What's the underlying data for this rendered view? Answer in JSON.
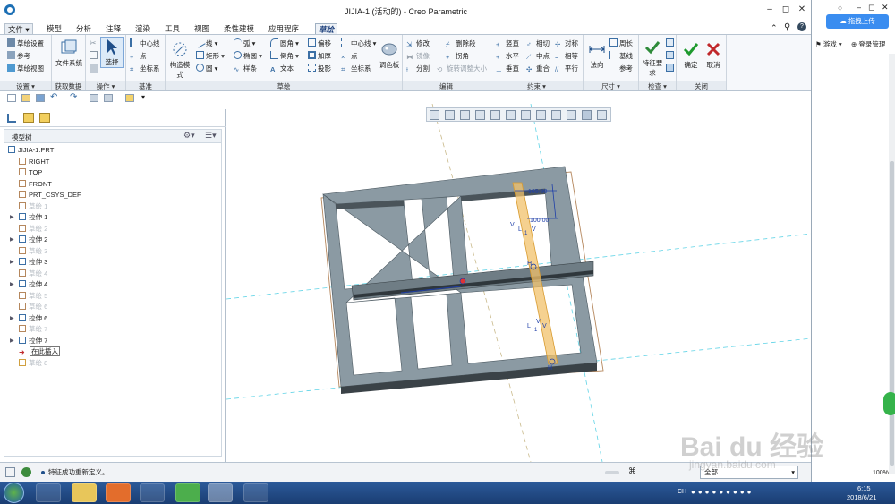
{
  "window": {
    "title": "JIJIA-1 (活动的) - Creo Parametric"
  },
  "menu": {
    "file": "文件",
    "tabs": [
      "模型",
      "分析",
      "注释",
      "渲染",
      "工具",
      "视图",
      "柔性建模",
      "应用程序"
    ],
    "active": "草绘"
  },
  "ribbon": {
    "setup": {
      "label": "设置",
      "items": [
        "草绘设置",
        "参考",
        "草绘视图"
      ]
    },
    "get_data": {
      "label": "获取数据",
      "file_system": "文件系统"
    },
    "operations": {
      "label": "操作",
      "select": "选择"
    },
    "datum": {
      "label": "基准",
      "items": [
        "中心线",
        "点",
        "坐标系"
      ]
    },
    "sketch": {
      "label": "草绘",
      "construct": "构造模式",
      "items": [
        "线",
        "弧",
        "圆角",
        "偏移",
        "中心线",
        "矩形",
        "椭圆",
        "倒角",
        "加厚",
        "点",
        "圆",
        "样条",
        "文本",
        "投影",
        "坐标系"
      ],
      "palette": "调色板"
    },
    "edit": {
      "label": "编辑",
      "items": [
        "修改",
        "删除段",
        "镜像",
        "拐角",
        "分割",
        "旋转调整大小"
      ]
    },
    "constrain": {
      "label": "约束",
      "items": [
        "竖直",
        "相切",
        "对称",
        "水平",
        "中点",
        "相等",
        "垂直",
        "重合",
        "平行"
      ]
    },
    "dimension": {
      "label": "尺寸",
      "normal": "法向",
      "items": [
        "周长",
        "基线",
        "参考"
      ]
    },
    "inspect": {
      "label": "检查",
      "feature_req": "特征要求"
    },
    "close": {
      "label": "关闭",
      "ok": "确定",
      "cancel": "取消"
    }
  },
  "model_tree": {
    "title": "模型树",
    "items": [
      {
        "label": "JIJIA-1.PRT",
        "kind": "part",
        "dim": false,
        "expand": false
      },
      {
        "label": "RIGHT",
        "kind": "plane",
        "dim": false,
        "expand": false
      },
      {
        "label": "TOP",
        "kind": "plane",
        "dim": false,
        "expand": false
      },
      {
        "label": "FRONT",
        "kind": "plane",
        "dim": false,
        "expand": false
      },
      {
        "label": "PRT_CSYS_DEF",
        "kind": "csys",
        "dim": false,
        "expand": false
      },
      {
        "label": "草绘 1",
        "kind": "sketch",
        "dim": true,
        "expand": false
      },
      {
        "label": "拉伸 1",
        "kind": "extrude",
        "dim": false,
        "expand": true
      },
      {
        "label": "草绘 2",
        "kind": "sketch",
        "dim": true,
        "expand": false
      },
      {
        "label": "拉伸 2",
        "kind": "extrude",
        "dim": false,
        "expand": true
      },
      {
        "label": "草绘 3",
        "kind": "sketch",
        "dim": true,
        "expand": false
      },
      {
        "label": "拉伸 3",
        "kind": "extrude",
        "dim": false,
        "expand": true
      },
      {
        "label": "草绘 4",
        "kind": "sketch",
        "dim": true,
        "expand": false
      },
      {
        "label": "拉伸 4",
        "kind": "extrude",
        "dim": false,
        "expand": true
      },
      {
        "label": "草绘 5",
        "kind": "sketch",
        "dim": true,
        "expand": false
      },
      {
        "label": "草绘 6",
        "kind": "sketch",
        "dim": true,
        "expand": false
      },
      {
        "label": "拉伸 6",
        "kind": "extrude",
        "dim": false,
        "expand": true
      },
      {
        "label": "草绘 7",
        "kind": "sketch",
        "dim": true,
        "expand": false
      },
      {
        "label": "拉伸 7",
        "kind": "extrude",
        "dim": false,
        "expand": true
      },
      {
        "label": "在此插入",
        "kind": "insert",
        "dim": false,
        "expand": false
      },
      {
        "label": "草绘 8",
        "kind": "sketch-active",
        "dim": true,
        "expand": false
      }
    ]
  },
  "graphics": {
    "dim1": "165.00",
    "dim2": "100.00",
    "constraint_v": "V",
    "constraint_h": "H",
    "constraint_l": "L",
    "constraint_1": "1"
  },
  "status": {
    "message": "特征成功重新定义。",
    "filter": "全部"
  },
  "browser": {
    "upload": "拖拽上传",
    "games": "游戏",
    "login": "登录管理"
  },
  "taskbar": {
    "time": "6:15",
    "date": "2018/6/21",
    "lang": "CH",
    "zoom": "100%"
  },
  "watermark": {
    "text": "Bai du 经验",
    "url": "jingyan.baidu.com"
  }
}
